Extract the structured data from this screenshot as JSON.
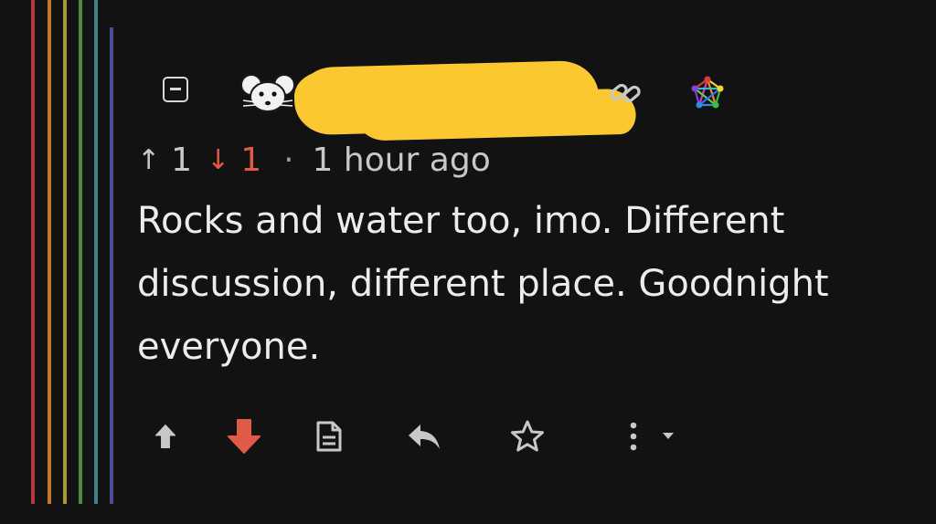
{
  "thread_line_colors": [
    "#b53a35",
    "#c7762a",
    "#a89a33",
    "#4f8a43",
    "#3e7f8c",
    "#4a4d9c"
  ],
  "comment": {
    "upvotes": "1",
    "downvotes": "1",
    "separator": "·",
    "timestamp": "1 hour ago",
    "body": "Rocks and water too, imo. Different discussion, different place. Goodnight everyone.",
    "author_redacted": true
  },
  "icons": {
    "collapse": "collapse-icon",
    "avatar": "mouse-avatar-icon",
    "link": "link-icon",
    "instance": "fediverse-icon",
    "upvote": "upvote-icon",
    "downvote": "downvote-icon",
    "source": "view-source-icon",
    "reply": "reply-icon",
    "save": "star-icon",
    "more": "more-options-icon"
  },
  "colors": {
    "background": "#121212",
    "text": "#ececec",
    "muted": "#c8c8c8",
    "downvote_active": "#e05a45",
    "redaction": "#fcc831"
  }
}
